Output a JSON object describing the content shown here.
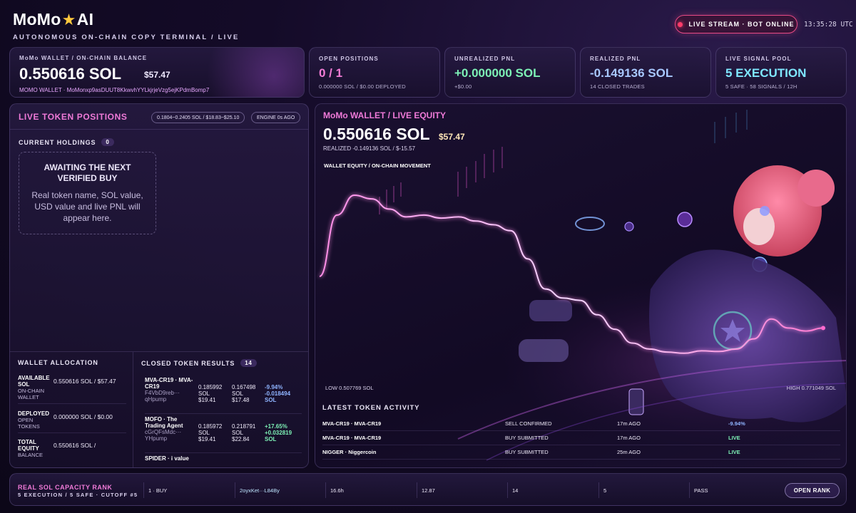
{
  "header": {
    "brand_left": "MoMo",
    "brand_star": "★",
    "brand_right": "AI",
    "subtitle": "AUTONOMOUS ON-CHAIN COPY TERMINAL / LIVE",
    "live_status": "LIVE STREAM · BOT ONLINE",
    "clock": "13:35:28 UTC"
  },
  "wallet": {
    "label": "MoMo WALLET / ON-CHAIN BALANCE",
    "balance": "0.550616 SOL",
    "usd": "$57.47",
    "address": "MOMO WALLET · MoMonxp9asDUUT8KkwvhYYLkjrjeVzg5ejKPdmBomp7"
  },
  "stats": [
    {
      "label": "OPEN POSITIONS",
      "value": "0 / 1",
      "sub": "0.000000 SOL / $0.00 DEPLOYED"
    },
    {
      "label": "UNREALIZED PNL",
      "value": "+0.000000 SOL",
      "sub": "+$0.00"
    },
    {
      "label": "REALIZED PNL",
      "value": "-0.149136 SOL",
      "sub": "14 CLOSED TRADES"
    },
    {
      "label": "LIVE SIGNAL POOL",
      "value": "5 EXECUTION",
      "sub": "5 SAFE · 58 SIGNALS / 12H"
    }
  ],
  "positions": {
    "title": "LIVE TOKEN POSITIONS",
    "range_chip": "0.1804~0.2405 SOL / $18.83~$25.10",
    "engine_chip": "ENGINE 0s AGO",
    "holdings_label": "CURRENT HOLDINGS",
    "holdings_count": "0",
    "empty_title": "AWAITING THE NEXT VERIFIED BUY",
    "empty_text": "Real token name, SOL value, USD value and live PNL will appear here."
  },
  "allocation": {
    "title": "WALLET ALLOCATION",
    "rows": [
      {
        "k1": "AVAILABLE SOL",
        "k2": "ON-CHAIN WALLET",
        "v": "0.550616 SOL / $57.47"
      },
      {
        "k1": "DEPLOYED",
        "k2": "OPEN TOKENS",
        "v": "0.000000 SOL / $0.00"
      },
      {
        "k1": "TOTAL EQUITY",
        "k2": "BALANCE",
        "v": "0.550616 SOL /"
      }
    ]
  },
  "closed": {
    "title": "CLOSED TOKEN RESULTS",
    "count": "14",
    "rows": [
      {
        "name": "MVA-CR19 · MVA-CR19",
        "addr": "F4VbD9reb··· qHpump",
        "in_sol": "0.185992 SOL",
        "in_usd": "$19.41",
        "out_sol": "0.167498 SOL",
        "out_usd": "$17.48",
        "pct": "-9.94%",
        "pnl": "-0.018494 SOL"
      },
      {
        "name": "MOFO · The Trading Agent",
        "addr": "cGrQFsMdc··· YHpump",
        "in_sol": "0.185972 SOL",
        "in_usd": "$19.41",
        "out_sol": "0.218791 SOL",
        "out_usd": "$22.84",
        "pct": "+17.65%",
        "pnl": "+0.032819 SOL"
      },
      {
        "name": "SPIDER · i value",
        "addr": "",
        "in_sol": "",
        "in_usd": "",
        "out_sol": "",
        "out_usd": "",
        "pct": "",
        "pnl": ""
      }
    ]
  },
  "equity": {
    "title": "MoMo WALLET / LIVE EQUITY",
    "balance": "0.550616 SOL",
    "usd": "$57.47",
    "realized": "REALIZED -0.149136 SOL / $-15.57",
    "chart_label": "WALLET EQUITY / ON-CHAIN MOVEMENT",
    "low": "LOW 0.507769 SOL",
    "high": "HIGH 0.771049 SOL"
  },
  "chart_data": {
    "type": "line",
    "title": "WALLET EQUITY / ON-CHAIN MOVEMENT",
    "series": [
      {
        "values": [
          0.636,
          0.738,
          0.771,
          0.765,
          0.748,
          0.735,
          0.738,
          0.733,
          0.735,
          0.728,
          0.722,
          0.712,
          0.665,
          0.615,
          0.6,
          0.596,
          0.572,
          0.548,
          0.525,
          0.515,
          0.51,
          0.508,
          0.512,
          0.511,
          0.515,
          0.532,
          0.565,
          0.55,
          0.545,
          0.55
        ]
      }
    ],
    "ylim": [
      0.507769,
      0.771049
    ],
    "grid": false
  },
  "activity": {
    "title": "LATEST TOKEN ACTIVITY",
    "rows": [
      {
        "name": "MVA-CR19 · MVA-CR19",
        "status": "SELL CONFIRMED",
        "time": "17m AGO",
        "result": "-9.94%",
        "color": "#8fb4ff"
      },
      {
        "name": "MVA-CR19 · MVA-CR19",
        "status": "BUY SUBMITTED",
        "time": "17m AGO",
        "result": "LIVE",
        "color": "#7df2b6"
      },
      {
        "name": "NIGGER · Niggercoin",
        "status": "BUY SUBMITTED",
        "time": "25m AGO",
        "result": "LIVE",
        "color": "#7df2b6"
      }
    ]
  },
  "rank": {
    "title": "REAL SOL CAPACITY RANK",
    "sub": "5 EXECUTION / 5 SAFE · CUTOFF #5",
    "cells": [
      "1 · BUY",
      "2oyxKet···L84By",
      "16.6h",
      "12.87",
      "14",
      "5",
      "PASS"
    ],
    "button": "OPEN RANK"
  },
  "colors": {
    "accent_pink": "#ef7ad8",
    "accent_green": "#7df2b6",
    "accent_blue": "#a8c8ff",
    "live_red": "#ff3c6a"
  }
}
